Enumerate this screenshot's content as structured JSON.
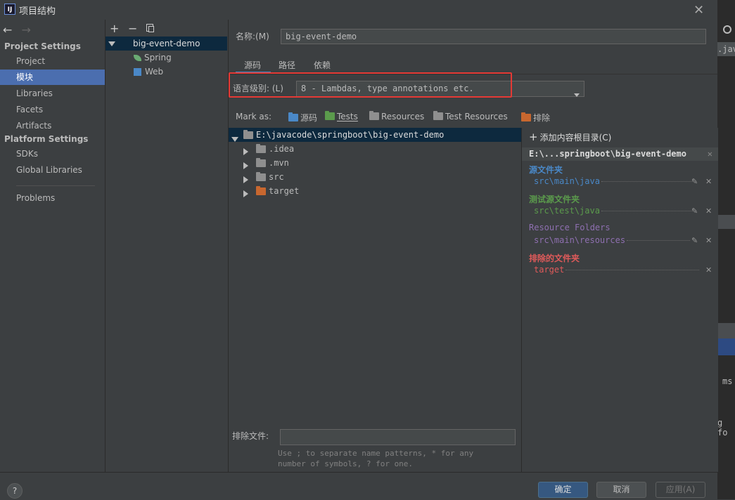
{
  "window": {
    "title": "项目结构",
    "app_icon": "IJ"
  },
  "nav": {
    "project_settings_header": "Project Settings",
    "project_items": [
      "Project",
      "模块",
      "Libraries",
      "Facets",
      "Artifacts"
    ],
    "platform_settings_header": "Platform Settings",
    "platform_items": [
      "SDKs",
      "Global Libraries"
    ],
    "problems": "Problems",
    "selected": "模块"
  },
  "modules": {
    "root": "big-event-demo",
    "children": [
      "Spring",
      "Web"
    ]
  },
  "content": {
    "name_label": "名称:(M)",
    "name_value": "big-event-demo",
    "tabs": [
      "源码",
      "路径",
      "依赖"
    ],
    "active_tab": "源码",
    "language_level_label": "语言级别: (L)",
    "language_level_value": "8 - Lambdas, type annotations etc.",
    "mark_as_label": "Mark as:",
    "mark_as": [
      {
        "label": "源码",
        "color": "#4a88c7"
      },
      {
        "label": "Tests",
        "color": "#5b9b4c"
      },
      {
        "label": "Resources",
        "color": "#8f8f8f"
      },
      {
        "label": "Test Resources",
        "color": "#8f8f8f"
      },
      {
        "label": "排除",
        "color": "#c8672f"
      }
    ],
    "tree_root": "E:\\javacode\\springboot\\big-event-demo",
    "tree_children": [
      {
        "name": ".idea",
        "color": "#8f8f8f"
      },
      {
        "name": ".mvn",
        "color": "#8f8f8f"
      },
      {
        "name": "src",
        "color": "#8f8f8f"
      },
      {
        "name": "target",
        "color": "#c8672f"
      }
    ],
    "add_root_label": "添加内容根目录(C)",
    "root_header": "E:\\...springboot\\big-event-demo",
    "sections": [
      {
        "title": "源文件夹",
        "path": "src\\main\\java",
        "color": "#4a88c7"
      },
      {
        "title": "测试源文件夹",
        "path": "src\\test\\java",
        "color": "#5b9b4c"
      },
      {
        "title": "Resource Folders",
        "path": "src\\main\\resources",
        "color": "#8e6fb0"
      },
      {
        "title": "排除的文件夹",
        "path": "target",
        "color": "#e05a5a"
      }
    ],
    "exclude_label": "排除文件:",
    "exclude_hint_1": "Use ; to separate name patterns, * for any",
    "exclude_hint_2": "number of symbols, ? for one."
  },
  "buttons": {
    "help": "?",
    "ok": "确定",
    "cancel": "取消",
    "apply": "应用(A)"
  },
  "ide_fragments": {
    "tab": ".jav",
    "a": "ms",
    "b": "g fo"
  }
}
